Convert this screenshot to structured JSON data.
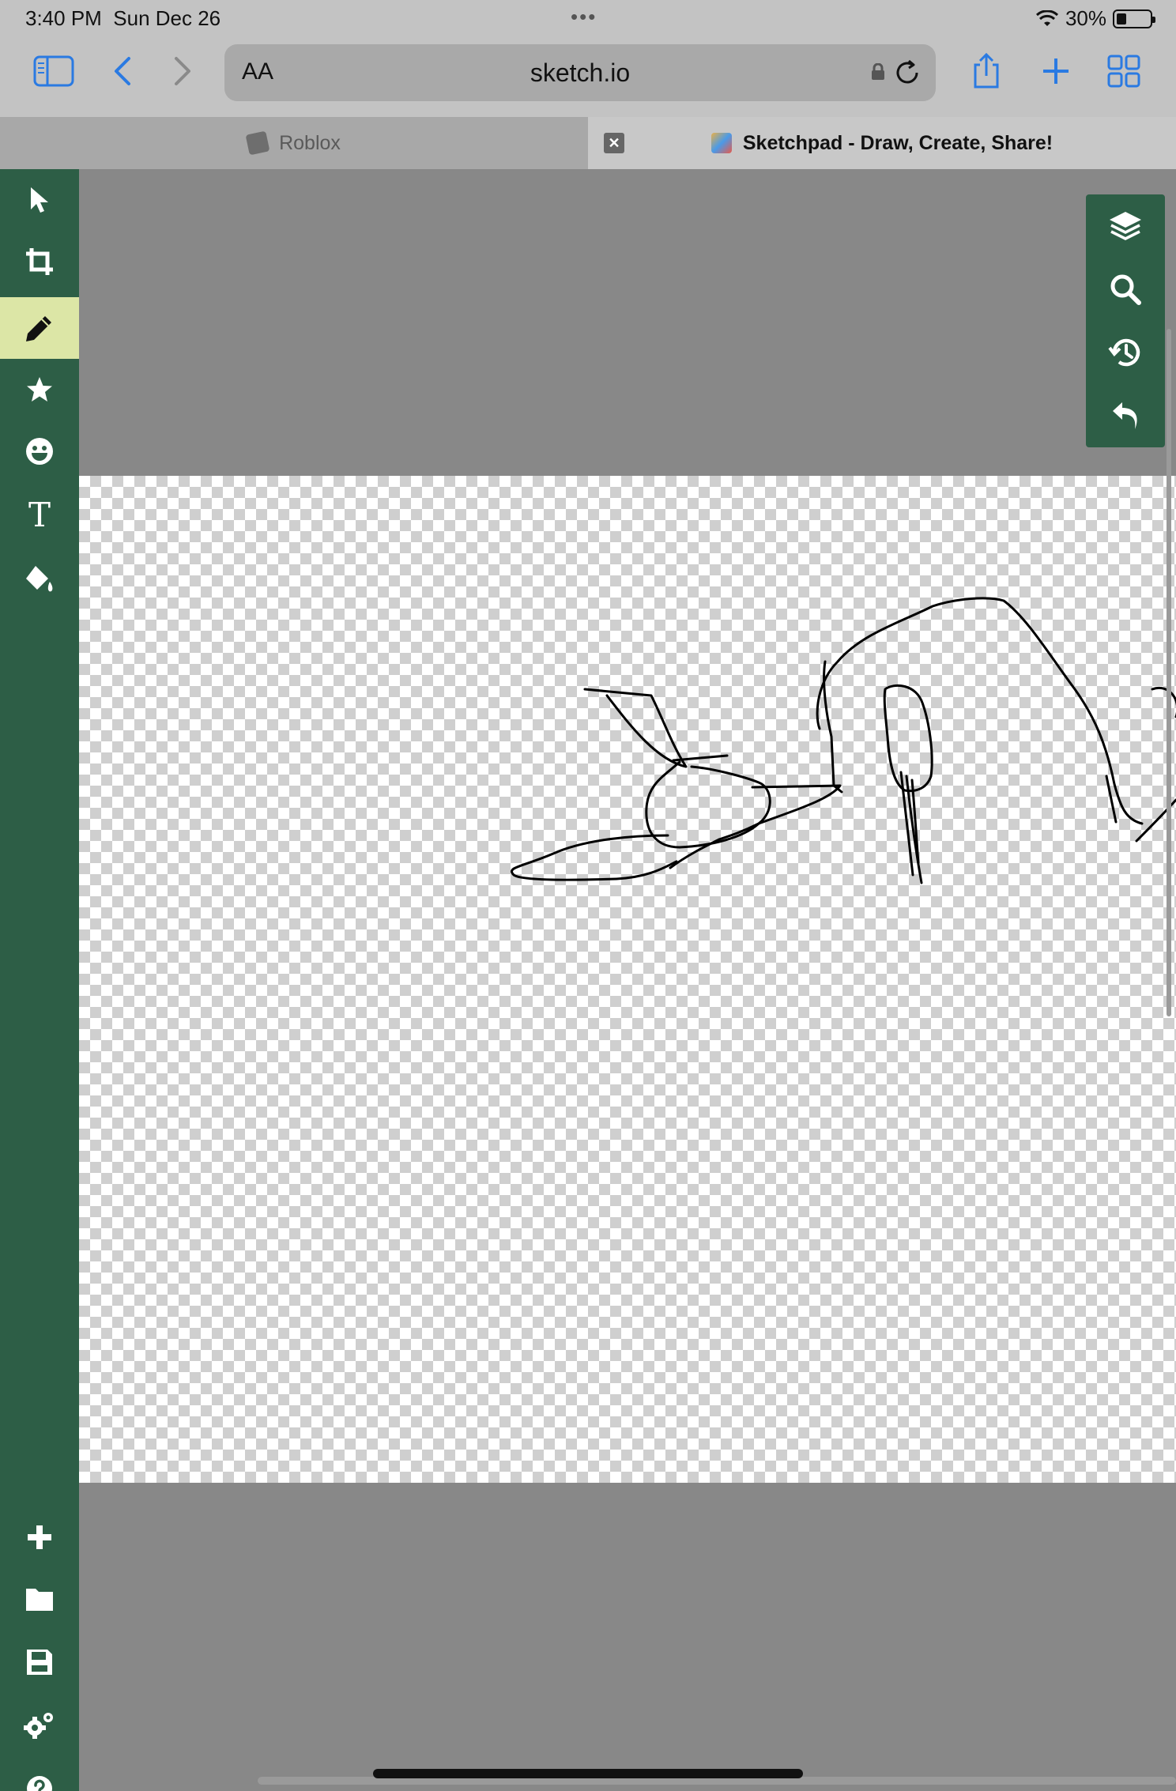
{
  "status": {
    "time": "3:40 PM",
    "date": "Sun Dec 26",
    "battery": "30%"
  },
  "browser": {
    "aa_label": "AA",
    "url": "sketch.io",
    "icons": [
      "sidebar-icon",
      "back-icon",
      "forward-icon",
      "lock-icon",
      "reload-icon",
      "share-icon",
      "new-tab-icon",
      "tab-overview-icon"
    ]
  },
  "tabs": [
    {
      "title": "Roblox",
      "active": false
    },
    {
      "title": "Sketchpad - Draw, Create, Share!",
      "active": true
    }
  ],
  "left_toolbar": {
    "items": [
      "select-icon",
      "crop-icon",
      "pencil-icon",
      "star-icon",
      "emoji-icon",
      "text-icon",
      "fill-bucket-icon"
    ],
    "bottom_items": [
      "plus-icon",
      "folder-icon",
      "save-icon",
      "settings-icon",
      "help-icon"
    ],
    "active": "pencil-icon",
    "text_tool_label": "T"
  },
  "right_panel": {
    "items": [
      "layers-icon",
      "zoom-icon",
      "history-icon",
      "undo-icon"
    ]
  },
  "colors": {
    "toolbar_bg": "#2d5e46",
    "active_tool_bg": "#dce6a6",
    "workspace_bg": "#888888",
    "link_blue": "#2a7ae2"
  }
}
